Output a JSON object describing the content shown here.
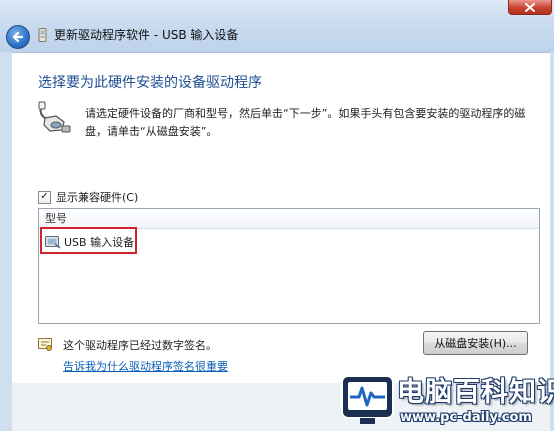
{
  "window": {
    "title": "更新驱动程序软件 - USB 输入设备",
    "close_icon": "close-icon",
    "back_icon": "back-arrow-icon",
    "app_icon": "device-manager-icon"
  },
  "page": {
    "heading": "选择要为此硬件安装的设备驱动程序",
    "instructions": "请选定硬件设备的厂商和型号，然后单击“下一步”。如果手头有包含要安装的驱动程序的磁盘，请单击“从磁盘安装”。",
    "hardware_icon": "hardware-icon"
  },
  "compat": {
    "label": "显示兼容硬件(C)",
    "checked": true
  },
  "model_list": {
    "header": "型号",
    "items": [
      {
        "label": "USB 输入设备",
        "icon": "hid-device-icon"
      }
    ]
  },
  "signature": {
    "status": "这个驱动程序已经过数字签名。",
    "icon": "signed-driver-icon",
    "link": "告诉我为什么驱动程序签名很重要"
  },
  "buttons": {
    "have_disk": "从磁盘安装(H)..."
  },
  "watermark": {
    "title": "电脑百科知识",
    "url": "www.pc-daily.com",
    "logo_icon": "monitor-pulse-logo-icon"
  },
  "colors": {
    "heading": "#1d4f91",
    "link": "#0b5fb7",
    "highlight": "#d2232a",
    "close": "#c8432f"
  }
}
